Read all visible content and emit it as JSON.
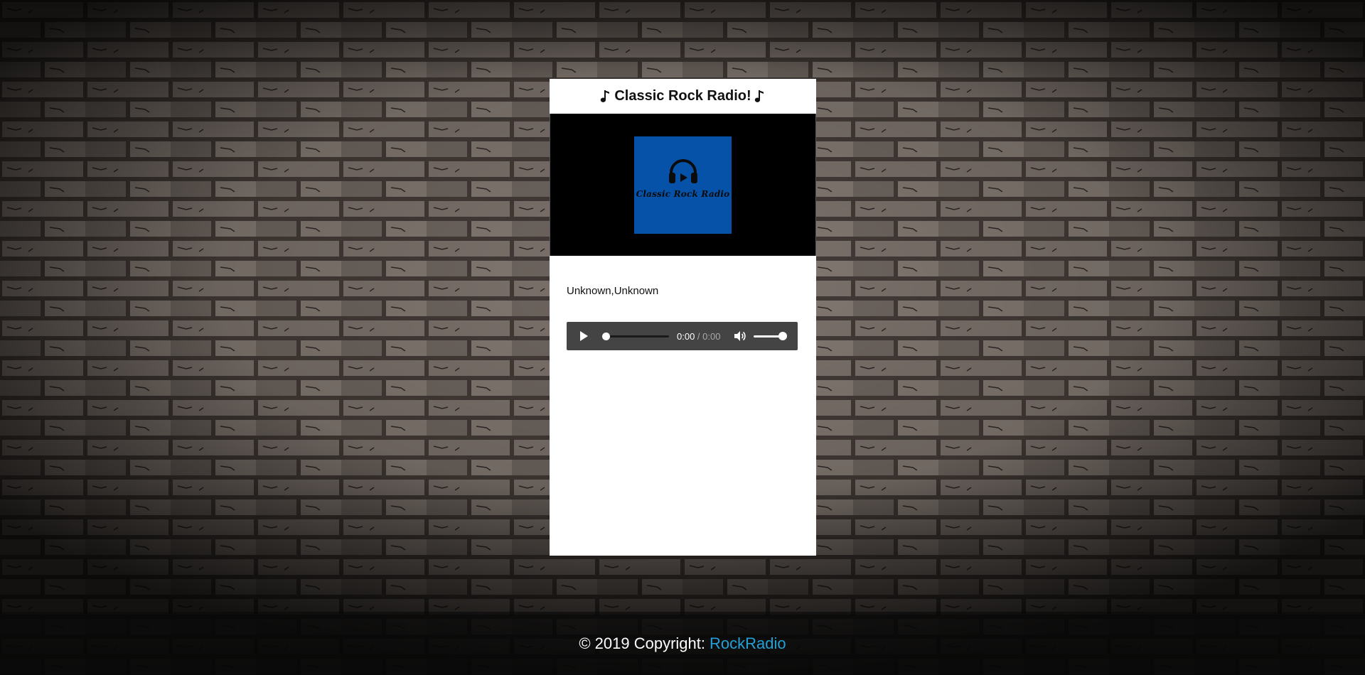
{
  "card": {
    "title": "Classic Rock Radio!",
    "icons": {
      "title_left": "music-note-icon",
      "title_right": "music-note-icon"
    }
  },
  "artwork": {
    "label": "Classic Rock Radio",
    "background_color": "#0752a9",
    "icon": "headphones-play-icon"
  },
  "track": {
    "info": "Unknown,Unknown"
  },
  "player": {
    "current_time": "0:00",
    "separator": " / ",
    "duration": "0:00",
    "progress": 0,
    "volume": 1.0,
    "icons": {
      "play": "play-icon",
      "mute": "volume-icon"
    }
  },
  "footer": {
    "copyright": "© 2019 Copyright:",
    "link_text": "RockRadio",
    "link_color": "#23a0d8"
  }
}
